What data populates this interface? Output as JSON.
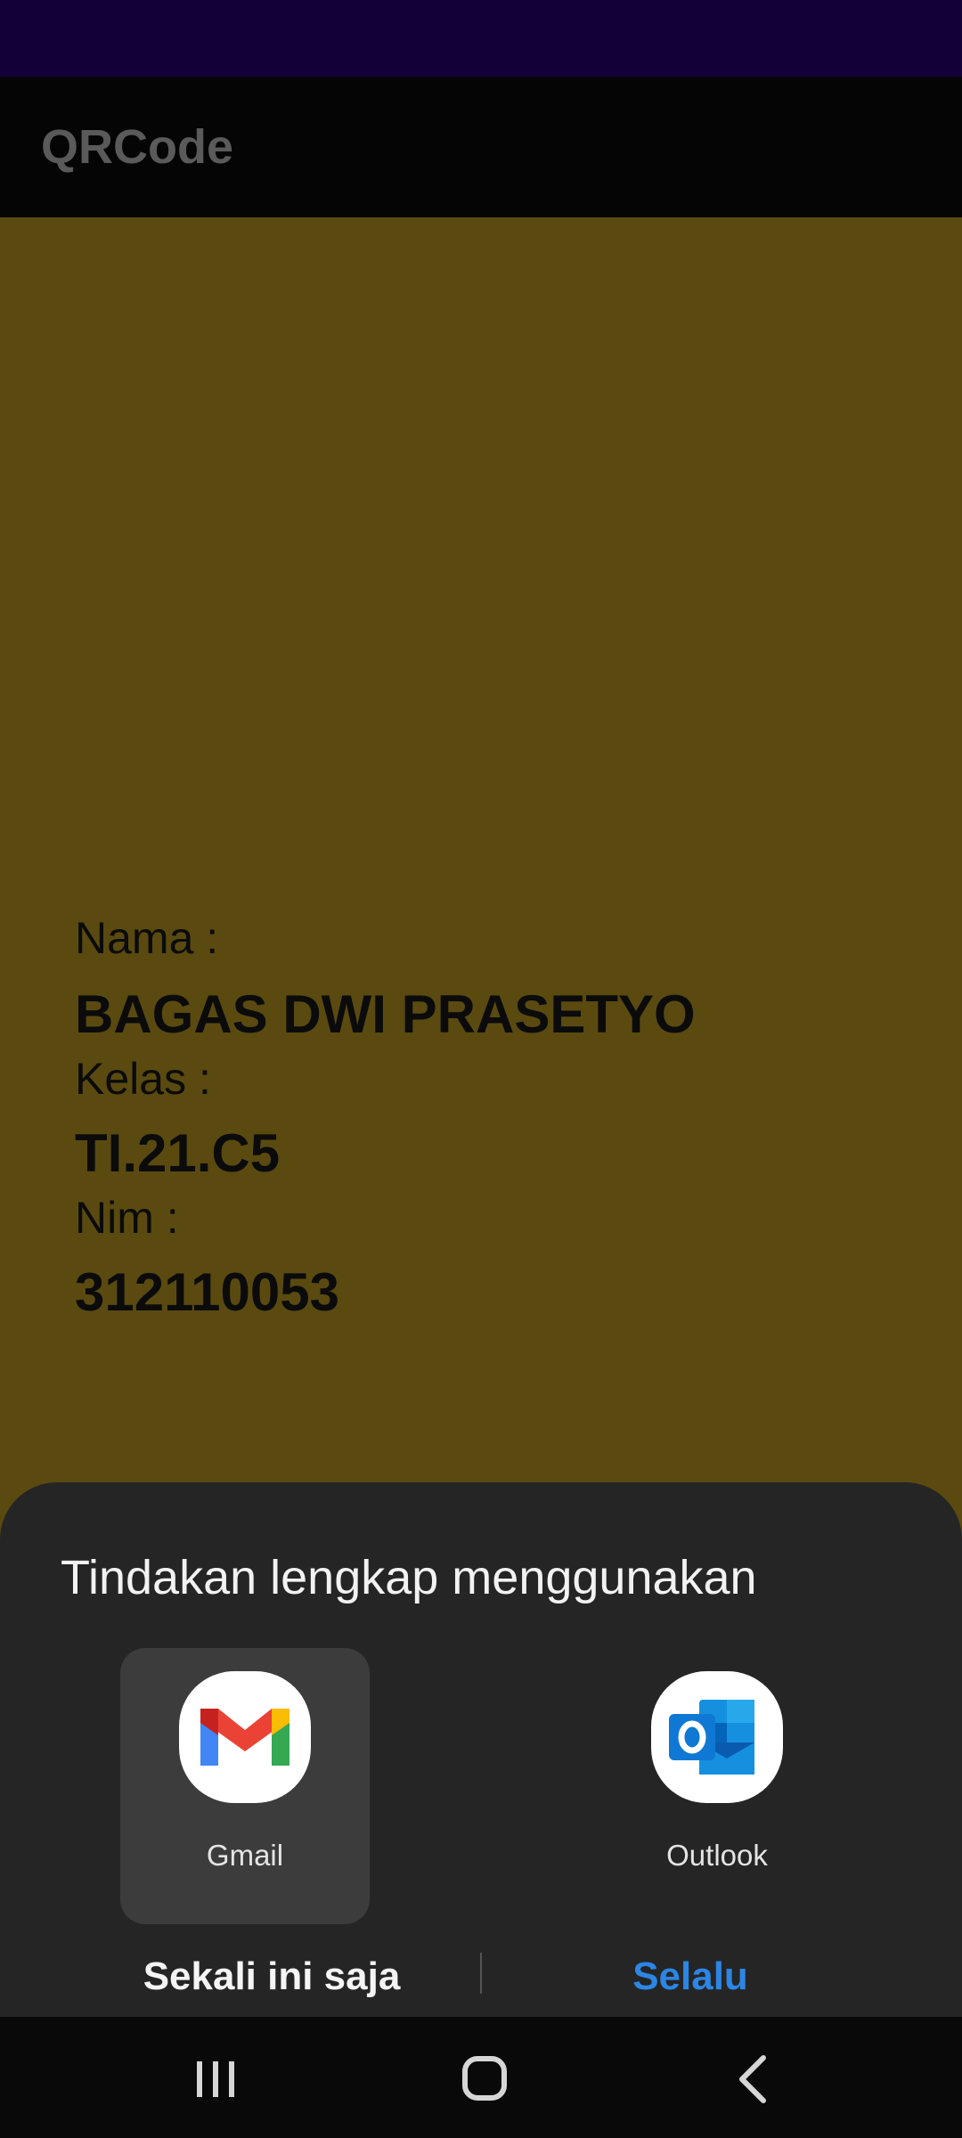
{
  "app_bar": {
    "title": "QRCode"
  },
  "profile": {
    "name_label": "Nama :",
    "name_value": "BAGAS DWI PRASETYO",
    "class_label": "Kelas :",
    "class_value": "TI.21.C5",
    "nim_label": "Nim :",
    "nim_value": "312110053"
  },
  "sheet": {
    "title": "Tindakan lengkap menggunakan",
    "apps": [
      {
        "label": "Gmail",
        "icon": "gmail-icon",
        "selected": true
      },
      {
        "label": "Outlook",
        "icon": "outlook-icon",
        "selected": false
      }
    ],
    "once_label": "Sekali ini saja",
    "always_label": "Selalu"
  },
  "nav": {
    "icons": [
      "recent-apps-icon",
      "home-icon",
      "back-icon"
    ]
  },
  "colors": {
    "status_bar": "#130039",
    "content_bg": "#5a4a10",
    "sheet_bg": "#252525",
    "accent": "#2b86e5"
  }
}
